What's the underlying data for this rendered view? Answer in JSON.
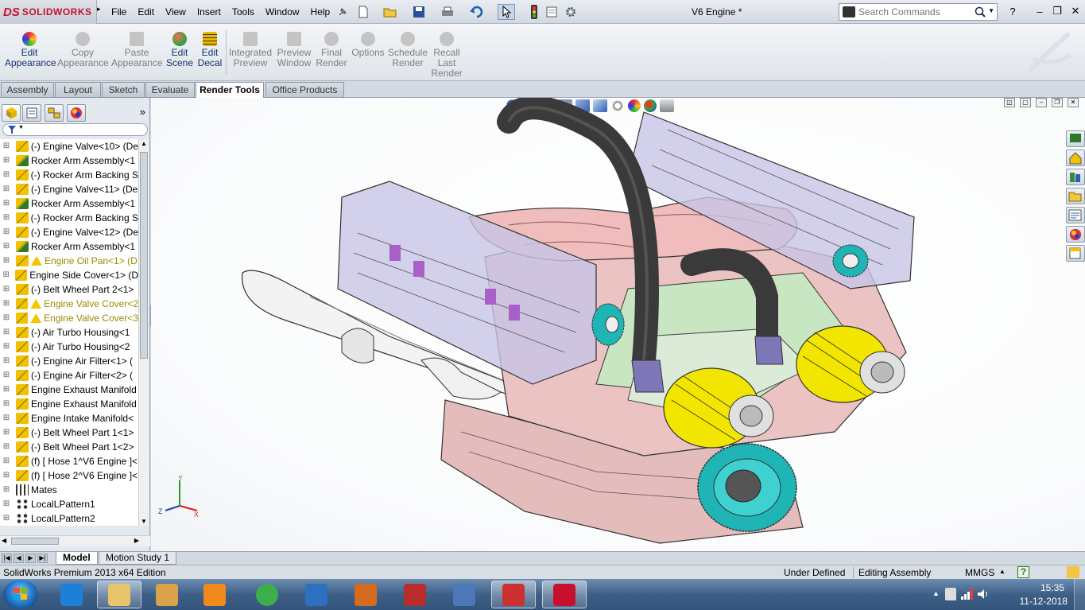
{
  "app": {
    "brand": "SOLIDWORKS",
    "brand_mark": "DS",
    "document_title": "V6 Engine *"
  },
  "menu": [
    "File",
    "Edit",
    "View",
    "Insert",
    "Tools",
    "Window",
    "Help"
  ],
  "search": {
    "placeholder": "Search Commands"
  },
  "command_manager": {
    "buttons": [
      {
        "label": "Edit\nAppearance",
        "enabled": true,
        "icon": "appearance-icon",
        "color": "#d33"
      },
      {
        "label": "Copy\nAppearance",
        "enabled": false,
        "icon": "copy-appearance-icon",
        "color": "#aaa"
      },
      {
        "label": "Paste\nAppearance",
        "enabled": false,
        "icon": "paste-appearance-icon",
        "color": "#aaa"
      },
      {
        "label": "Edit\nScene",
        "enabled": true,
        "icon": "scene-icon",
        "color": "#3a3"
      },
      {
        "label": "Edit\nDecal",
        "enabled": true,
        "icon": "decal-icon",
        "color": "#e6b800"
      },
      {
        "label": "Integrated\nPreview",
        "enabled": false,
        "icon": "integrated-preview-icon",
        "color": "#aaa"
      },
      {
        "label": "Preview\nWindow",
        "enabled": false,
        "icon": "preview-window-icon",
        "color": "#aaa"
      },
      {
        "label": "Final\nRender",
        "enabled": false,
        "icon": "final-render-icon",
        "color": "#aaa"
      },
      {
        "label": "Options",
        "enabled": false,
        "icon": "options-icon",
        "color": "#aaa"
      },
      {
        "label": "Schedule\nRender",
        "enabled": false,
        "icon": "schedule-render-icon",
        "color": "#aaa"
      },
      {
        "label": "Recall\nLast\nRender",
        "enabled": false,
        "icon": "recall-render-icon",
        "color": "#aaa"
      }
    ]
  },
  "tabs": [
    {
      "label": "Assembly",
      "active": false
    },
    {
      "label": "Layout",
      "active": false
    },
    {
      "label": "Sketch",
      "active": false
    },
    {
      "label": "Evaluate",
      "active": false
    },
    {
      "label": "Render Tools",
      "active": true
    },
    {
      "label": "Office Products",
      "active": false
    }
  ],
  "feature_tree": [
    {
      "label": "(-) Engine Valve<10> (De",
      "icon": "part",
      "warning": false
    },
    {
      "label": "Rocker Arm Assembly<1",
      "icon": "assembly",
      "warning": false
    },
    {
      "label": "(-) Rocker Arm Backing S",
      "icon": "part",
      "warning": false
    },
    {
      "label": "(-) Engine Valve<11> (De",
      "icon": "part",
      "warning": false
    },
    {
      "label": "Rocker Arm Assembly<1",
      "icon": "assembly",
      "warning": false
    },
    {
      "label": "(-) Rocker Arm Backing S",
      "icon": "part",
      "warning": false
    },
    {
      "label": "(-) Engine Valve<12> (De",
      "icon": "part",
      "warning": false
    },
    {
      "label": "Rocker Arm Assembly<1",
      "icon": "assembly",
      "warning": false
    },
    {
      "label": "Engine Oil Pan<1> (D",
      "icon": "part",
      "warning": true
    },
    {
      "label": "Engine Side Cover<1> (D",
      "icon": "part",
      "warning": false
    },
    {
      "label": "(-) Belt Wheel Part  2<1>",
      "icon": "part",
      "warning": false
    },
    {
      "label": "Engine Valve Cover<2",
      "icon": "part",
      "warning": true
    },
    {
      "label": "Engine Valve Cover<3",
      "icon": "part",
      "warning": true
    },
    {
      "label": "(-) Air Turbo Housing<1",
      "icon": "part",
      "warning": false
    },
    {
      "label": "(-) Air Turbo Housing<2",
      "icon": "part",
      "warning": false
    },
    {
      "label": "(-) Engine Air Filter<1> (",
      "icon": "part",
      "warning": false
    },
    {
      "label": "(-) Engine Air Filter<2> (",
      "icon": "part",
      "warning": false
    },
    {
      "label": "Engine Exhaust Manifold",
      "icon": "part",
      "warning": false
    },
    {
      "label": "Engine Exhaust Manifold",
      "icon": "part",
      "warning": false
    },
    {
      "label": "Engine Intake Manifold<",
      "icon": "part",
      "warning": false
    },
    {
      "label": "(-) Belt Wheel Part  1<1>",
      "icon": "part",
      "warning": false
    },
    {
      "label": "(-) Belt Wheel Part  1<2>",
      "icon": "part",
      "warning": false
    },
    {
      "label": "(f) [ Hose 1^V6 Engine ]<",
      "icon": "part",
      "warning": false
    },
    {
      "label": "(f) [ Hose 2^V6 Engine ]<",
      "icon": "part",
      "warning": false
    },
    {
      "label": "Mates",
      "icon": "mates",
      "warning": false
    },
    {
      "label": "LocalLPattern1",
      "icon": "pattern",
      "warning": false
    },
    {
      "label": "LocalLPattern2",
      "icon": "pattern",
      "warning": false
    }
  ],
  "triad": {
    "x": "X",
    "y": "Y",
    "z": "Z"
  },
  "model_tabs": [
    {
      "label": "Model",
      "active": true
    },
    {
      "label": "Motion Study 1",
      "active": false
    }
  ],
  "status": {
    "edition": "SolidWorks Premium 2013 x64 Edition",
    "definition": "Under Defined",
    "mode": "Editing Assembly",
    "units": "MMGS",
    "units_arrow": "▲",
    "help": "?"
  },
  "taskbar": {
    "apps": [
      {
        "name": "internet-explorer",
        "color": "#1e7fd8"
      },
      {
        "name": "file-explorer",
        "color": "#e8c46a"
      },
      {
        "name": "paint",
        "color": "#d9a24b"
      },
      {
        "name": "uc-browser",
        "color": "#f08a1c"
      },
      {
        "name": "chrome",
        "color": "#3cae4c"
      },
      {
        "name": "webcam",
        "color": "#2f6fc0"
      },
      {
        "name": "media-player",
        "color": "#d66a1f"
      },
      {
        "name": "screen-recorder",
        "color": "#b82c2c"
      },
      {
        "name": "keyboard",
        "color": "#4c78b8"
      },
      {
        "name": "snipping-tool",
        "color": "#cc3030"
      },
      {
        "name": "solidworks",
        "color": "#c8102e"
      }
    ],
    "time": "15:35",
    "date": "11-12-2018"
  },
  "colors": {
    "brand": "#c8102e",
    "engine_block": "#e8b6b6",
    "hose": "#3a3a3a",
    "filter": "#f2e600",
    "pulley": "#1fb5b5",
    "valve_cover": "#c8c4e6"
  }
}
